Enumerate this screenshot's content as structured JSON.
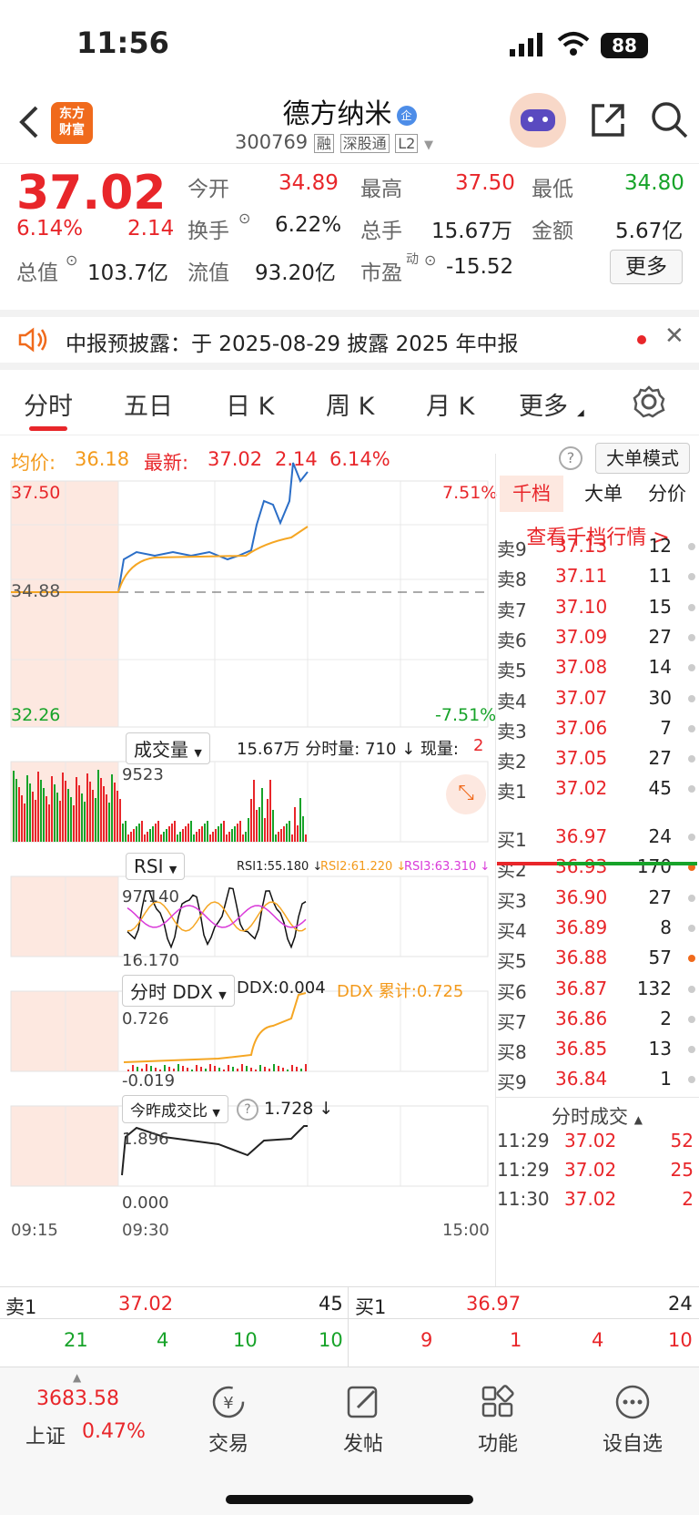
{
  "status": {
    "time": "11:56",
    "battery": "88"
  },
  "header": {
    "logo": "东方\n财富",
    "stock_name": "德方纳米",
    "enterprise_badge": "企",
    "code": "300769",
    "tags": [
      "融",
      "深股通",
      "L2"
    ]
  },
  "quote": {
    "price": "37.02",
    "change_pct": "6.14%",
    "change": "2.14",
    "fields": [
      {
        "label": "今开",
        "value": "34.89"
      },
      {
        "label": "最高",
        "value": "37.50"
      },
      {
        "label": "最低",
        "value": "34.80"
      },
      {
        "label": "换手",
        "value": "6.22%"
      },
      {
        "label": "总手",
        "value": "15.67万"
      },
      {
        "label": "金额",
        "value": "5.67亿"
      },
      {
        "label": "总值",
        "value": "103.7亿"
      },
      {
        "label": "流值",
        "value": "93.20亿"
      },
      {
        "label": "市盈",
        "value": "-15.52"
      }
    ],
    "pe_sup": "动",
    "more": "更多"
  },
  "notice": {
    "text": "中报预披露：于 2025-08-29 披露 2025 年中报"
  },
  "tabs": [
    "分时",
    "五日",
    "日 K",
    "周 K",
    "月 K",
    "更多"
  ],
  "info": {
    "avg_label": "均价:",
    "avg": "36.18",
    "last_label": "最新:",
    "last": "37.02",
    "chg": "2.14",
    "pct": "6.14%",
    "mode": "大单模式"
  },
  "axis": {
    "top": "37.50",
    "mid": "34.88",
    "bottom": "32.26",
    "top_pct": "7.51%",
    "bottom_pct": "-7.51%",
    "t_open": "09:15",
    "t_start": "09:30",
    "t_end": "15:00"
  },
  "volume": {
    "label": "成交量",
    "text": "15.67万 分时量: 710 ↓ 现量: ",
    "cur": "2",
    "max": "9523"
  },
  "rsi": {
    "label": "RSI",
    "rsi1": "RSI1:55.180 ↓",
    "rsi2": "RSI2:61.220 ↓",
    "rsi3": "RSI3:63.310 ↓",
    "max": "97.140",
    "min": "16.170"
  },
  "ddx": {
    "label": "分时 DDX",
    "ddx": "DDX:0.004",
    "ddx_cum": "DDX 累计:0.725",
    "max": "0.726",
    "min": "-0.019"
  },
  "ratio": {
    "label": "今昨成交比",
    "value": "1.728 ↓",
    "max": "1.896",
    "min": "0.000"
  },
  "orderbook": {
    "tabs": [
      "千档",
      "大单",
      "分价"
    ],
    "link": "查看千档行情 >",
    "asks": [
      [
        "卖9",
        "37.13",
        "12"
      ],
      [
        "卖8",
        "37.11",
        "11"
      ],
      [
        "卖7",
        "37.10",
        "15"
      ],
      [
        "卖6",
        "37.09",
        "27"
      ],
      [
        "卖5",
        "37.08",
        "14"
      ],
      [
        "卖4",
        "37.07",
        "30"
      ],
      [
        "卖3",
        "37.06",
        "7"
      ],
      [
        "卖2",
        "37.05",
        "27"
      ],
      [
        "卖1",
        "37.02",
        "45"
      ]
    ],
    "bids": [
      [
        "买1",
        "36.97",
        "24"
      ],
      [
        "买2",
        "36.93",
        "170"
      ],
      [
        "买3",
        "36.90",
        "27"
      ],
      [
        "买4",
        "36.89",
        "8"
      ],
      [
        "买5",
        "36.88",
        "57"
      ],
      [
        "买6",
        "36.87",
        "132"
      ],
      [
        "买7",
        "36.86",
        "2"
      ],
      [
        "买8",
        "36.85",
        "13"
      ],
      [
        "买9",
        "36.84",
        "1"
      ]
    ],
    "trades_title": "分时成交",
    "trades": [
      [
        "11:29",
        "37.02",
        "52"
      ],
      [
        "11:29",
        "37.02",
        "25"
      ],
      [
        "11:30",
        "37.02",
        "2"
      ]
    ]
  },
  "bottom_bar": {
    "sell_label": "卖1",
    "sell_price": "37.02",
    "sell_vol": "45",
    "buy_label": "买1",
    "buy_price": "36.97",
    "buy_vol": "24",
    "sell_nums": [
      "21",
      "4",
      "10",
      "10"
    ],
    "buy_nums": [
      "9",
      "1",
      "4",
      "10"
    ]
  },
  "nav": {
    "index_value": "3683.58",
    "index_name": "上证",
    "index_pct": "0.47%",
    "items": [
      "交易",
      "发帖",
      "功能",
      "设自选"
    ]
  }
}
